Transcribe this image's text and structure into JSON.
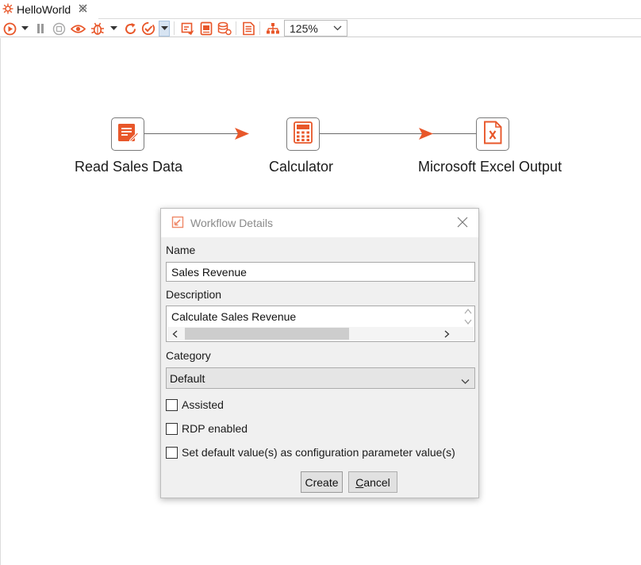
{
  "tab": {
    "title": "HelloWorld",
    "close_glyph": "⛝"
  },
  "toolbar": {
    "icons": [
      "run-icon",
      "pause-icon",
      "stop-icon",
      "preview-icon",
      "debug-icon",
      "replay-icon",
      "verify-icon",
      "impact-icon",
      "sql-icon",
      "explore-db-icon",
      "show-results-icon",
      "align-icon"
    ],
    "zoom_value": "125%",
    "accent_color": "#e8572a"
  },
  "canvas": {
    "nodes": [
      {
        "label": "Read Sales Data",
        "icon": "text-file-input-icon"
      },
      {
        "label": "Calculator",
        "icon": "calculator-icon"
      },
      {
        "label": "Microsoft Excel Output",
        "icon": "excel-output-icon"
      }
    ]
  },
  "dialog": {
    "title": "Workflow Details",
    "name_label": "Name",
    "name_value": "Sales Revenue",
    "description_label": "Description",
    "description_value": "Calculate Sales Revenue",
    "category_label": "Category",
    "category_value": "Default",
    "checkboxes": [
      {
        "label": "Assisted",
        "checked": false
      },
      {
        "label": "RDP enabled",
        "checked": false
      },
      {
        "label": "Set default value(s) as configuration parameter value(s)",
        "checked": false
      }
    ],
    "create_label": "Create",
    "cancel_label": "Cancel",
    "cancel_mnemonic": "C",
    "cancel_rest": "ancel"
  }
}
